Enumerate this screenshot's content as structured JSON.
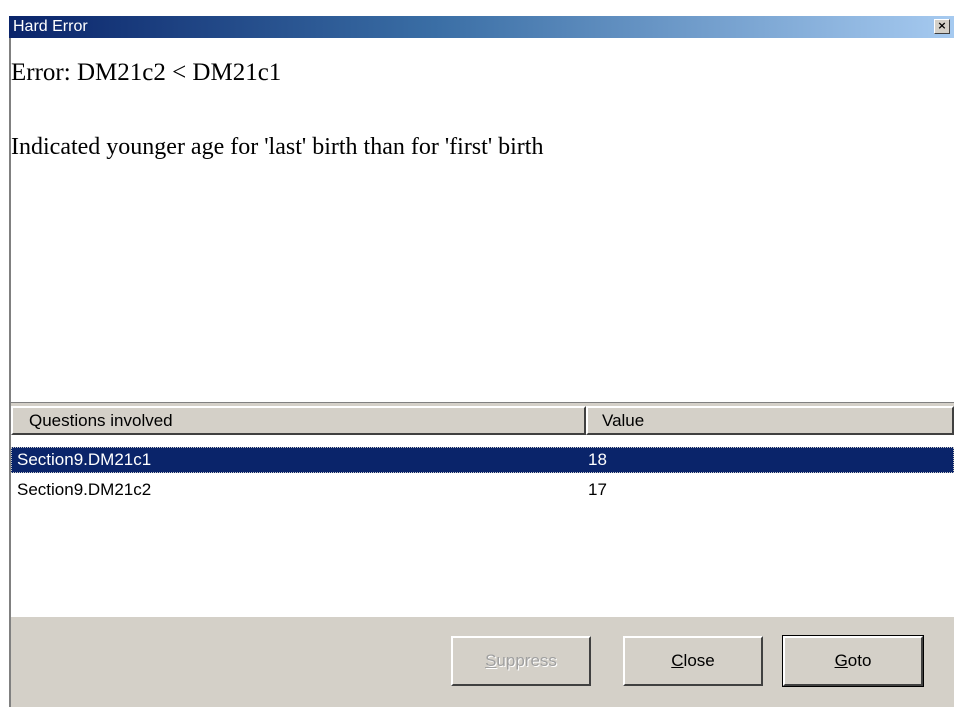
{
  "window": {
    "title": "Hard Error",
    "close_glyph": "×"
  },
  "message": {
    "error": "Error: DM21c2 < DM21c1",
    "description": "Indicated younger age for 'last' birth than for 'first' birth"
  },
  "grid": {
    "columns": [
      "Questions involved",
      "Value"
    ],
    "rows": [
      {
        "question": "Section9.DM21c1",
        "value": "18",
        "selected": true
      },
      {
        "question": "Section9.DM21c2",
        "value": "17",
        "selected": false
      }
    ]
  },
  "buttons": {
    "suppress": {
      "mnemonic": "S",
      "rest": "uppress",
      "enabled": false
    },
    "close": {
      "mnemonic": "C",
      "rest": "lose",
      "enabled": true
    },
    "goto": {
      "mnemonic": "G",
      "rest": "oto",
      "enabled": true
    }
  },
  "colors": {
    "titlebar_start": "#0a246a",
    "titlebar_end": "#a6caf0",
    "selection": "#0a246a",
    "face": "#d4d0c8"
  }
}
